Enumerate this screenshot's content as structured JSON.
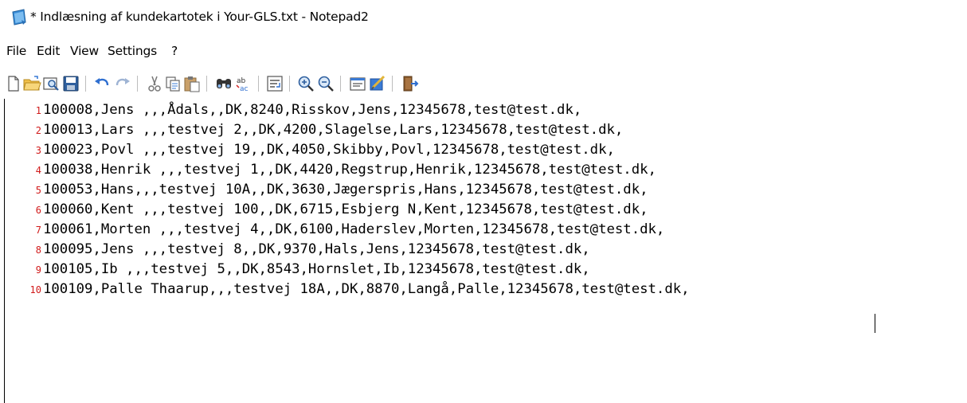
{
  "window": {
    "title": "* Indlæsning af kundekartotek i Your-GLS.txt - Notepad2"
  },
  "menu": [
    {
      "label": "File"
    },
    {
      "label": "Edit"
    },
    {
      "label": "View"
    },
    {
      "label": "Settings"
    },
    {
      "label": "?"
    }
  ],
  "toolbar": {
    "buttons": [
      {
        "icon": "new-file-icon"
      },
      {
        "icon": "open-folder-icon"
      },
      {
        "icon": "browse-icon"
      },
      {
        "icon": "save-icon"
      },
      {
        "icon": "undo-icon"
      },
      {
        "icon": "redo-icon"
      },
      {
        "icon": "cut-icon"
      },
      {
        "icon": "copy-icon"
      },
      {
        "icon": "paste-icon"
      },
      {
        "icon": "find-icon"
      },
      {
        "icon": "replace-icon"
      },
      {
        "icon": "wordwrap-icon"
      },
      {
        "icon": "zoom-in-icon"
      },
      {
        "icon": "zoom-out-icon"
      },
      {
        "icon": "scheme-icon"
      },
      {
        "icon": "customize-icon"
      },
      {
        "icon": "exit-icon"
      }
    ]
  },
  "editor": {
    "lines": [
      {
        "number": "1",
        "text": "100008,Jens ,,,Ådals,,DK,8240,Risskov,Jens,12345678,test@test.dk,"
      },
      {
        "number": "2",
        "text": "100013,Lars ,,,testvej 2,,DK,4200,Slagelse,Lars,12345678,test@test.dk,"
      },
      {
        "number": "3",
        "text": "100023,Povl ,,,testvej 19,,DK,4050,Skibby,Povl,12345678,test@test.dk,"
      },
      {
        "number": "4",
        "text": "100038,Henrik ,,,testvej 1,,DK,4420,Regstrup,Henrik,12345678,test@test.dk,"
      },
      {
        "number": "5",
        "text": "100053,Hans,,,testvej 10A,,DK,3630,Jægerspris,Hans,12345678,test@test.dk,"
      },
      {
        "number": "6",
        "text": "100060,Kent ,,,testvej 100,,DK,6715,Esbjerg N,Kent,12345678,test@test.dk,"
      },
      {
        "number": "7",
        "text": "100061,Morten ,,,testvej 4,,DK,6100,Haderslev,Morten,12345678,test@test.dk,"
      },
      {
        "number": "8",
        "text": "100095,Jens ,,,testvej 8,,DK,9370,Hals,Jens,12345678,test@test.dk,"
      },
      {
        "number": "9",
        "text": "100105,Ib ,,,testvej 5,,DK,8543,Hornslet,Ib,12345678,test@test.dk,"
      },
      {
        "number": "10",
        "text": "100109,Palle Thaarup,,,testvej 18A,,DK,8870,Langå,Palle,12345678,test@test.dk,"
      }
    ]
  },
  "colors": {
    "line_number": "#d11a1a",
    "text": "#000000",
    "background": "#ffffff"
  }
}
